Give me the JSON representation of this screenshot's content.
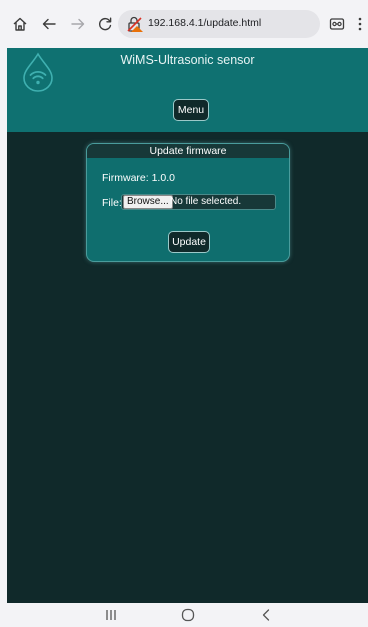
{
  "browser": {
    "url": "192.168.4.1/update.html",
    "icons": [
      "home-icon",
      "back-icon",
      "forward-icon",
      "reload-icon",
      "site-info-icon",
      "reader-mode-icon",
      "more-options-icon"
    ]
  },
  "page": {
    "title": "WiMS-Ultrasonic sensor",
    "menu_label": "Menu",
    "card": {
      "title": "Update firmware",
      "firmware_label": "Firmware:",
      "firmware_version": "1.0.0",
      "file_label": "File:",
      "browse_label": "Browse...",
      "file_status": "No file selected.",
      "update_label": "Update"
    }
  },
  "system_nav": {
    "icons": [
      "recents-icon",
      "home-nav-icon",
      "back-nav-icon"
    ]
  },
  "colors": {
    "header": "#0f7171",
    "background": "#10292a",
    "card": "#0f6e6e",
    "card_title_bar": "#173838"
  }
}
